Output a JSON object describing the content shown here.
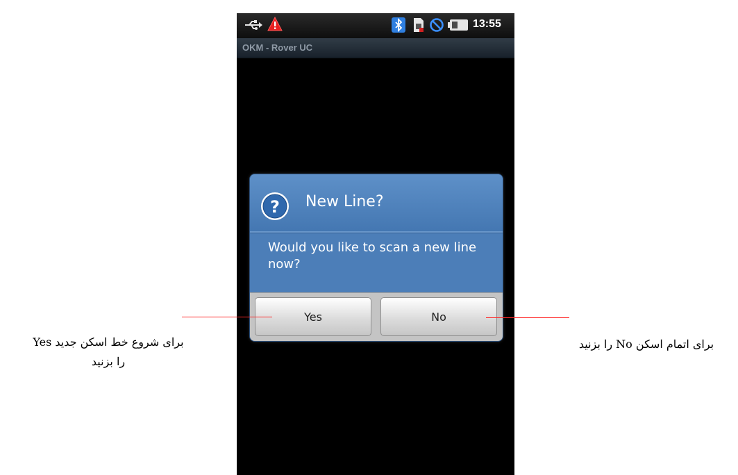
{
  "status_bar": {
    "time": "13:55",
    "icons": [
      "usb-icon",
      "warning-icon",
      "bluetooth-icon",
      "sim-icon",
      "no-signal-icon",
      "battery-icon"
    ]
  },
  "app": {
    "title": "OKM - Rover UC"
  },
  "dialog": {
    "icon": "question-icon",
    "title": "New Line?",
    "message": "Would you like to scan a new line now?",
    "buttons": {
      "yes": "Yes",
      "no": "No"
    }
  },
  "annotations": {
    "left_line1": "برای شروع خط اسکن جدید Yes",
    "left_line2": "را بزنید",
    "right": "برای اتمام اسکن No را بزنید"
  },
  "colors": {
    "dialog_bg": "#4c7eb8",
    "callout_line": "#ff2a2a",
    "screen_bg": "#000000"
  }
}
